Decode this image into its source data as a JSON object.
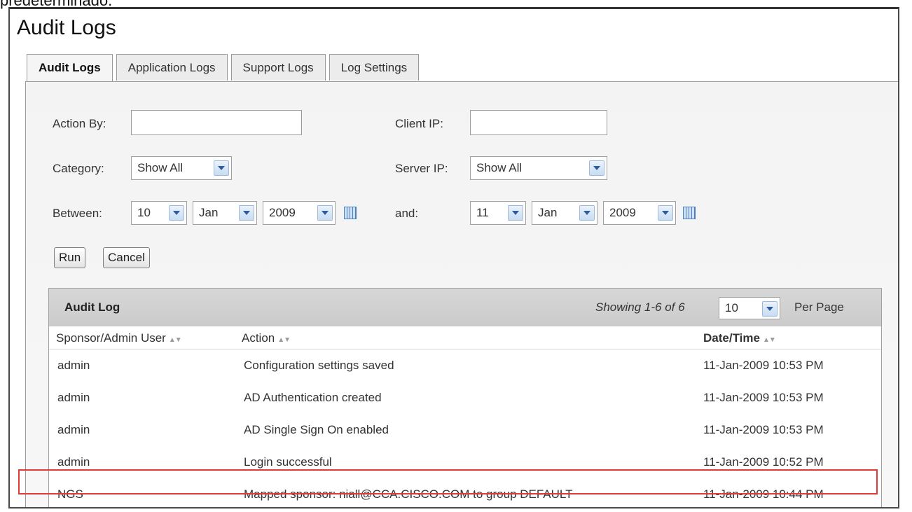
{
  "caption": "predeterminado.",
  "window": {
    "title": "Audit Logs"
  },
  "tabs": [
    {
      "label": "Audit Logs",
      "active": true
    },
    {
      "label": "Application Logs",
      "active": false
    },
    {
      "label": "Support Logs",
      "active": false
    },
    {
      "label": "Log Settings",
      "active": false
    }
  ],
  "filters": {
    "action_by": {
      "label": "Action By:",
      "value": ""
    },
    "client_ip": {
      "label": "Client IP:",
      "value": ""
    },
    "category": {
      "label": "Category:",
      "selected": "Show All"
    },
    "server_ip": {
      "label": "Server IP:",
      "selected": "Show All"
    },
    "between": {
      "label": "Between:",
      "day": "10",
      "month": "Jan",
      "year": "2009"
    },
    "and": {
      "label": "and:",
      "day": "11",
      "month": "Jan",
      "year": "2009"
    }
  },
  "buttons": {
    "run": "Run",
    "cancel": "Cancel"
  },
  "grid": {
    "title": "Audit Log",
    "showing": "Showing 1-6 of 6",
    "per_page_value": "10",
    "per_page_label": "Per Page",
    "columns": [
      "Sponsor/Admin User",
      "Action",
      "Date/Time"
    ],
    "rows": [
      {
        "user": "admin",
        "action": "Configuration settings saved",
        "datetime": "11-Jan-2009 10:53 PM"
      },
      {
        "user": "admin",
        "action": "AD Authentication created",
        "datetime": "11-Jan-2009 10:53 PM"
      },
      {
        "user": "admin",
        "action": "AD Single Sign On enabled",
        "datetime": "11-Jan-2009 10:53 PM"
      },
      {
        "user": "admin",
        "action": "Login successful",
        "datetime": "11-Jan-2009 10:52 PM"
      },
      {
        "user": "NGS",
        "action": "Mapped sponsor: niall@CCA.CISCO.COM to group DEFAULT",
        "datetime": "11-Jan-2009 10:44 PM"
      }
    ]
  },
  "colors": {
    "highlight": "#e03b3b",
    "dropdown_arrow": "#2d5d9f"
  }
}
